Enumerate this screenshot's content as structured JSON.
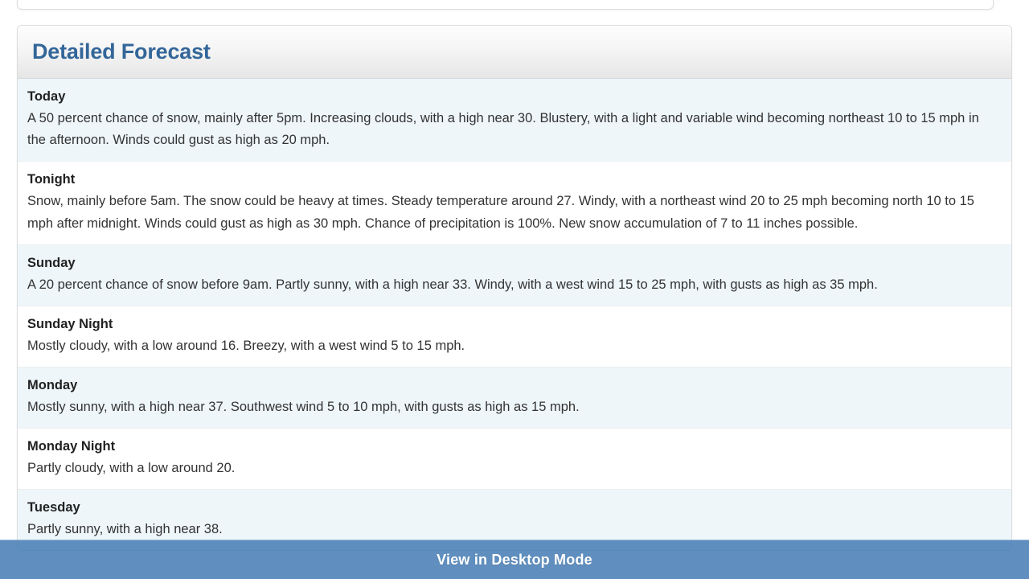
{
  "panel": {
    "title": "Detailed Forecast",
    "accent_color": "#336699",
    "stripe_color": "#eef6fa"
  },
  "forecast": {
    "periods": [
      {
        "name": "Today",
        "text": "A 50 percent chance of snow, mainly after 5pm. Increasing clouds, with a high near 30. Blustery, with a light and variable wind becoming northeast 10 to 15 mph in the afternoon. Winds could gust as high as 20 mph."
      },
      {
        "name": "Tonight",
        "text": "Snow, mainly before 5am. The snow could be heavy at times. Steady temperature around 27. Windy, with a northeast wind 20 to 25 mph becoming north 10 to 15 mph after midnight. Winds could gust as high as 30 mph. Chance of precipitation is 100%. New snow accumulation of 7 to 11 inches possible."
      },
      {
        "name": "Sunday",
        "text": "A 20 percent chance of snow before 9am. Partly sunny, with a high near 33. Windy, with a west wind 15 to 25 mph, with gusts as high as 35 mph."
      },
      {
        "name": "Sunday Night",
        "text": "Mostly cloudy, with a low around 16. Breezy, with a west wind 5 to 15 mph."
      },
      {
        "name": "Monday",
        "text": "Mostly sunny, with a high near 37. Southwest wind 5 to 10 mph, with gusts as high as 15 mph."
      },
      {
        "name": "Monday Night",
        "text": "Partly cloudy, with a low around 20."
      },
      {
        "name": "Tuesday",
        "text": "Partly sunny, with a high near 38."
      }
    ]
  },
  "bottom_bar": {
    "label": "View in Desktop Mode",
    "background_color": "#4a7cb5"
  }
}
